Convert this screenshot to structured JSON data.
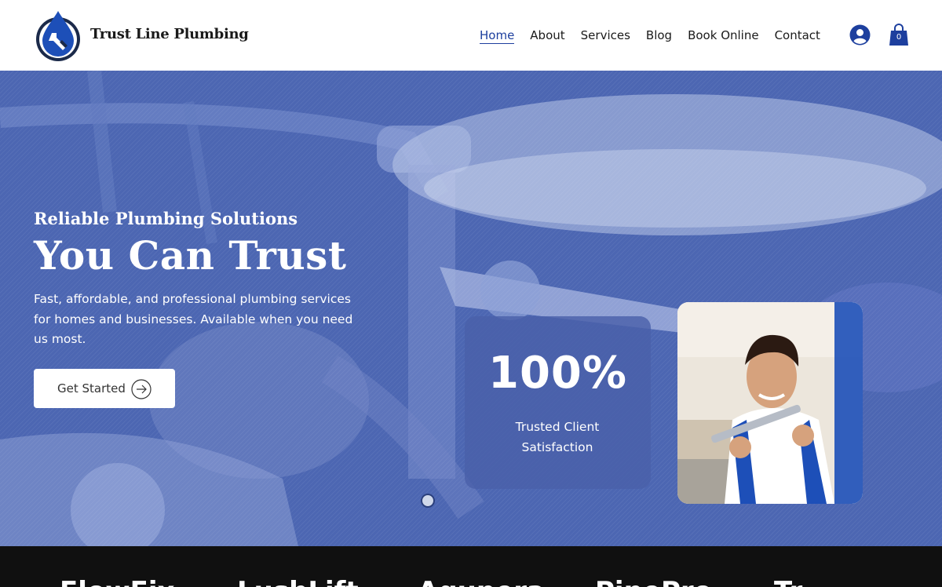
{
  "header": {
    "brand": "Trust Line Plumbing",
    "nav": [
      {
        "label": "Home",
        "active": true
      },
      {
        "label": "About",
        "active": false
      },
      {
        "label": "Services",
        "active": false
      },
      {
        "label": "Blog",
        "active": false
      },
      {
        "label": "Book Online",
        "active": false
      },
      {
        "label": "Contact",
        "active": false
      }
    ],
    "account_icon": "user-circle-icon",
    "cart_icon": "shopping-bag-icon",
    "cart_count": "0"
  },
  "hero": {
    "subtitle": "Reliable Plumbing Solutions",
    "title": "You Can Trust",
    "description": "Fast, affordable, and professional plumbing services for homes and businesses. Available when you need us most.",
    "cta_label": "Get Started",
    "cta_icon": "arrow-right-circle-icon",
    "stat_value": "100%",
    "stat_label": "Trusted Client Satisfaction"
  },
  "brand_strip": {
    "items": [
      "FlowFix",
      "LushLift",
      "Aqupera",
      "PipePro",
      "Tr"
    ]
  },
  "colors": {
    "accent": "#1d3f9e",
    "hero_overlay": "#4b63ad",
    "strip_bg": "#101010"
  }
}
